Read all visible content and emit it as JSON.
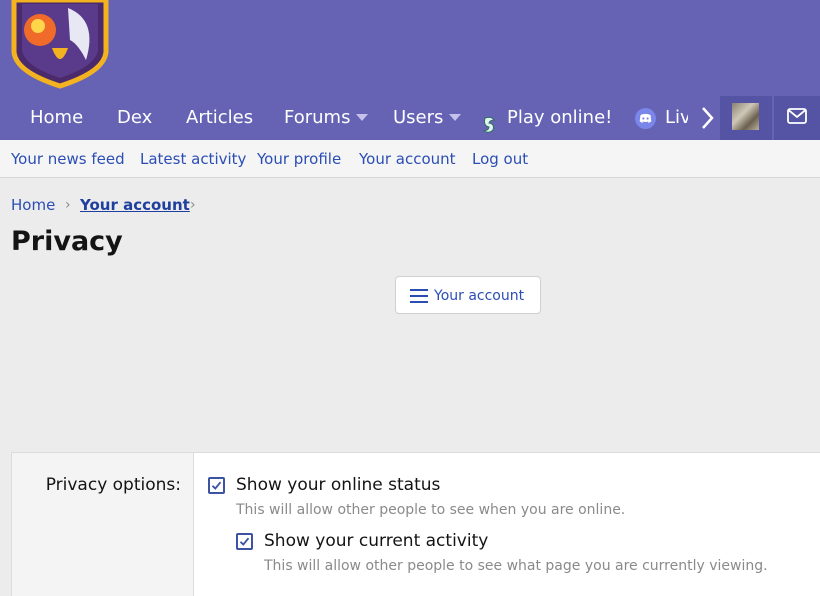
{
  "nav": {
    "items": [
      {
        "label": "Home"
      },
      {
        "label": "Dex"
      },
      {
        "label": "Articles"
      },
      {
        "label": "Forums"
      },
      {
        "label": "Users"
      },
      {
        "label": "Play online!"
      },
      {
        "label": "Live"
      }
    ]
  },
  "subnav": {
    "links": [
      "Your news feed",
      "Latest activity",
      "Your profile",
      "Your account",
      "Log out"
    ]
  },
  "breadcrumb": {
    "items": [
      "Home",
      "Your account"
    ]
  },
  "page": {
    "title": "Privacy"
  },
  "account_menu_button": {
    "label": "Your account"
  },
  "form": {
    "label": "Privacy options:",
    "options": [
      {
        "label": "Show your online status",
        "hint": "This will allow other people to see when you are online.",
        "checked": true
      },
      {
        "label": "Show your current activity",
        "hint": "This will allow other people to see what page you are currently viewing.",
        "checked": true
      }
    ]
  },
  "colors": {
    "header": "#6663b5",
    "link": "#2b4eb5",
    "checkbox": "#3b53a3"
  }
}
